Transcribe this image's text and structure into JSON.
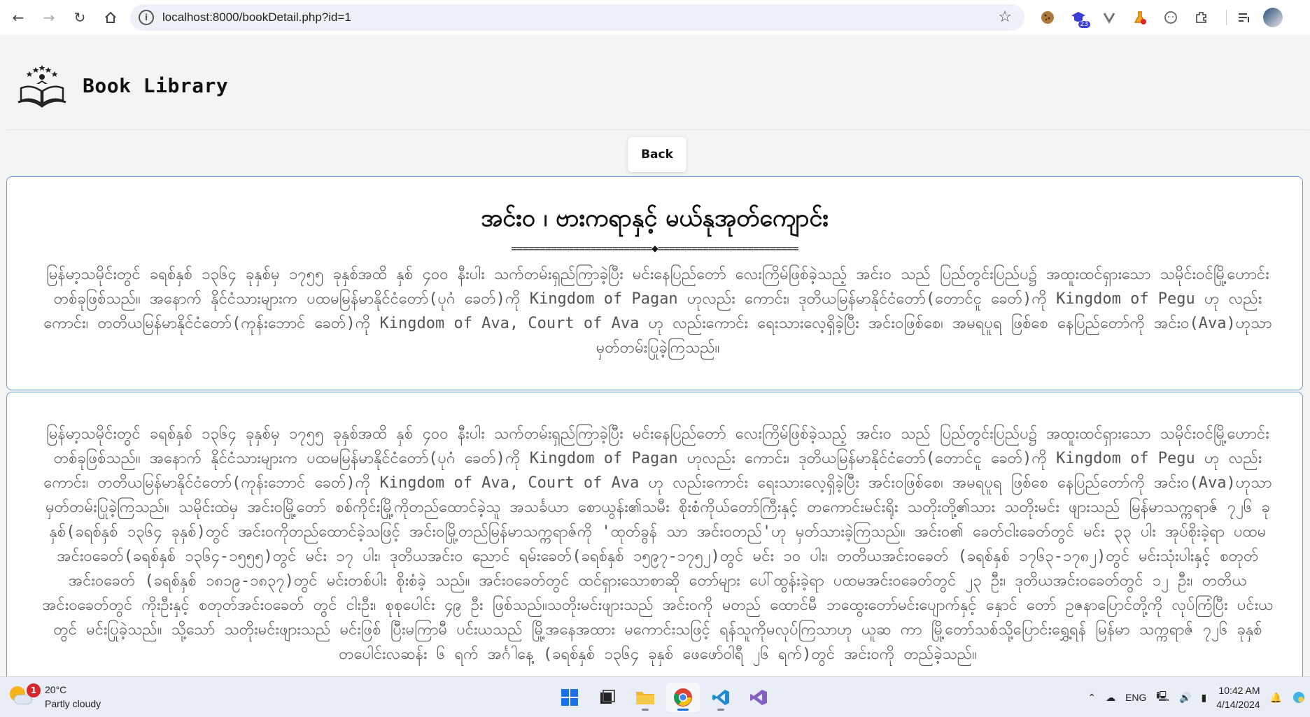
{
  "browser": {
    "url": "localhost:8000/bookDetail.php?id=1",
    "extensions": [
      {
        "name": "cookie-icon"
      },
      {
        "name": "graduation-cap-icon",
        "badge": "23"
      },
      {
        "name": "vee-icon"
      },
      {
        "name": "flask-icon"
      },
      {
        "name": "face-icon"
      },
      {
        "name": "puzzle-icon"
      }
    ]
  },
  "site": {
    "title": "Book Library"
  },
  "back_button": {
    "label": "Back"
  },
  "book": {
    "title": "အင်းဝ ၊ ဗားကရာနှင့် မယ်နုအုတ်ကျောင်း",
    "divider_left": "=========================",
    "divider_right": "=========================",
    "summary": "မြန်မာ့သမိုင်းတွင် ခရစ်နှစ် ၁၃၆၄ ခုနှစ်မှ ၁၇၅၅ ခုနှစ်အထိ နှစ် ၄၀၀ နီးပါး သက်တမ်းရှည်ကြာခဲ့ပြီး မင်းနေပြည်တော် လေးကြိမ်ဖြစ်ခဲ့သည့် အင်းဝ သည် ပြည်တွင်းပြည်ပ၌ အထူးထင်ရှားသော သမိုင်းဝင်မြို့ဟောင်းတစ်ခုဖြစ်သည်။ အနောက် နိုင်ငံသားများက ပထမမြန်မာနိုင်ငံတော်(ပုဂံ ခေတ်)ကို Kingdom of Pagan ဟုလည်း ကောင်း၊ ဒုတိယမြန်မာနိုင်ငံတော်(တောင်ငူ ခေတ်)ကို Kingdom of Pegu ဟု လည်း ကောင်း၊ တတိယမြန်မာနိုင်ငံတော်(ကုန်းဘောင် ခေတ်)ကို Kingdom of Ava, Court of Ava ဟု လည်းကောင်း ရေးသားလေ့ရှိခဲ့ပြီး အင်းဝဖြစ်စေ၊ အမရပူရ ဖြစ်စေ နေပြည်တော်ကို အင်းဝ(Ava)ဟုသာ မှတ်တမ်းပြုခဲ့ကြသည်။",
    "content": "မြန်မာ့သမိုင်းတွင် ခရစ်နှစ် ၁၃၆၄ ခုနှစ်မှ ၁၇၅၅ ခုနှစ်အထိ နှစ် ၄၀၀ နီးပါး သက်တမ်းရှည်ကြာခဲ့ပြီး မင်းနေပြည်တော် လေးကြိမ်ဖြစ်ခဲ့သည့် အင်းဝ သည် ပြည်တွင်းပြည်ပ၌ အထူးထင်ရှားသော သမိုင်းဝင်မြို့ဟောင်းတစ်ခုဖြစ်သည်။ အနောက် နိုင်ငံသားများက ပထမမြန်မာနိုင်ငံတော်(ပုဂံ ခေတ်)ကို Kingdom of Pagan ဟုလည်း ကောင်း၊ ဒုတိယမြန်မာနိုင်ငံတော်(တောင်ငူ ခေတ်)ကို Kingdom of Pegu ဟု လည်း ကောင်း၊ တတိယမြန်မာနိုင်ငံတော်(ကုန်းဘောင် ခေတ်)ကို Kingdom of Ava, Court of Ava ဟု လည်းကောင်း ရေးသားလေ့ရှိခဲ့ပြီး အင်းဝဖြစ်စေ၊ အမရပူရ ဖြစ်စေ နေပြည်တော်ကို အင်းဝ(Ava)ဟုသာ မှတ်တမ်းပြုခဲ့ကြသည်။ သမိုင်းထဲမှ အင်းဝမြို့တော် စစ်ကိုင်းမြို့ကိုတည်ထောင်ခဲ့သူ အသင်္ခယာ စောယွန်း၏သမီး စိုးစံကိုယ်တော်ကြီးနှင့် တကောင်းမင်းရိုး သတိုးတို့၏သား သတိုးမင်း ဖျားသည် မြန်မာသက္ကရာဇ် ၇၂၆ ခုနှစ်(ခရစ်နှစ် ၁၃၆၄ ခုနှစ်)တွင် အင်းဝကိုတည်ထောင်ခဲ့သဖြင့် အင်းဝမြို့တည်မြန်မာသက္ကရာဇ်ကို 'ထုတ်ခွန် သာ အင်းဝတည်'ဟု မှတ်သားခဲ့ကြသည်။ အင်းဝ၏ ခေတ်ငါးခေတ်တွင် မင်း ၃၃ ပါး အုပ်စိုးခဲ့ရာ ပထမအင်းဝခေတ်(ခရစ်နှစ် ၁၃၆၄-၁၅၅၅)တွင် မင်း ၁၇ ပါး၊ ဒုတိယအင်းဝ ညောင် ရမ်းခေတ်(ခရစ်နှစ် ၁၅၉၇-၁၇၅၂)တွင် မင်း ၁၀ ပါး၊ တတိယအင်းဝခေတ် (ခရစ်နှစ် ၁၇၆၃-၁၇၈၂)တွင် မင်းသုံးပါးနှင့် စတုတ်အင်းဝခေတ် (ခရစ်နှစ် ၁၈၁၉-၁၈၃၇)တွင် မင်းတစ်ပါး စိုးစံခဲ့ သည်။ အင်းဝခေတ်တွင် ထင်ရှားသောစာဆို တော်များ ပေါ်ထွန်းခဲ့ရာ ပထမအင်းဝခေတ်တွင် ၂၃ ဦး၊ ဒုတိယအင်းဝခေတ်တွင် ၁၂ ဦး၊ တတိယ အင်းဝခေတ်တွင် ကိုးဦးနှင့် စတုတ်အင်းဝခေတ် တွင် ငါးဦး၊ စုစုပေါင်း ၄၉ ဦး ဖြစ်သည်။သတိုးမင်းဖျားသည် အင်းဝကို မတည် ထောင်မီ ဘထွေးတော်မင်းပျောက်နှင့် နှောင် တော် ဥဇနာပြောင်တို့ကို လုပ်ကြံပြီး ပင်းယတွင် မင်းပြုခဲ့သည်။ သို့သော် သတိုးမင်းဖျားသည် မင်းဖြစ် ပြီးမကြာမီ ပင်းယသည် မြို့အနေအထား မကောင်းသဖြင့် ရန်သူကိုမလုပ်ကြသာဟု ယူဆ ကာ မြို့တော်သစ်သို့ပြောင်းရွှေ့ရန် မြန်မာ သက္ကရာဇ် ၇၂၆ ခုနှစ် တပေါင်းလဆန်း ၆ ရက် အင်္ဂါနေ့ (ခရစ်နှစ် ၁၃၆၄ ခုနှစ် ဖေဖော်ဝါရီ ၂၆ ရက်)တွင် အင်းဝကို တည်ခဲ့သည်။"
  },
  "taskbar": {
    "weather_badge": "1",
    "temperature": "20°C",
    "condition": "Partly cloudy",
    "apps": [
      "start-icon",
      "task-view-icon",
      "file-explorer-icon",
      "chrome-icon",
      "vscode-icon",
      "visual-studio-icon"
    ],
    "language": "ENG",
    "time": "10:42 AM",
    "date": "4/14/2024"
  }
}
